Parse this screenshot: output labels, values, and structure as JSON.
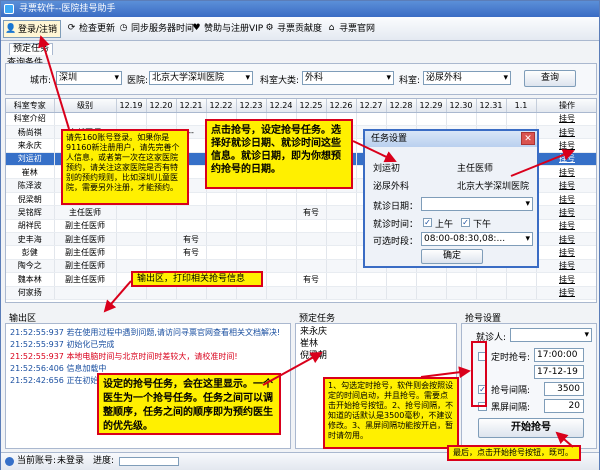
{
  "window": {
    "title": "寻票软件--医院挂号助手"
  },
  "toolbar": {
    "items": [
      {
        "label": "登录/注销",
        "icon": "user-icon"
      },
      {
        "label": "检查更新",
        "icon": "refresh-icon"
      },
      {
        "label": "同步服务器时间",
        "icon": "clock-icon"
      },
      {
        "label": "赞助与注册VIP",
        "icon": "heart-icon"
      },
      {
        "label": "寻票贡献度",
        "icon": "gear-icon"
      },
      {
        "label": "寻票官网",
        "icon": "home-icon"
      }
    ]
  },
  "tabs": {
    "appointment": "预定任务"
  },
  "query": {
    "section_label": "查询条件",
    "city_label": "城市:",
    "city_value": "深圳",
    "hospital_label": "医院:",
    "hospital_value": "北京大学深圳医院",
    "dept_type_label": "科室大类:",
    "dept_type_value": "外科",
    "dept_label": "科室:",
    "dept_value": "泌尿外科",
    "search_button": "查询"
  },
  "grid": {
    "headers": [
      "科室专家",
      "级别",
      "12.19",
      "12.20",
      "12.21",
      "12.22",
      "12.23",
      "12.24",
      "12.25",
      "12.26",
      "12.27",
      "12.28",
      "12.29",
      "12.30",
      "12.31",
      "1.1",
      "操作"
    ],
    "rows": [
      {
        "name": "科室介绍",
        "level": "",
        "cells": [
          "",
          "",
          "",
          "",
          "",
          "",
          "",
          "",
          "",
          "",
          "",
          "",
          "",
          ""
        ],
        "op": "挂号"
      },
      {
        "name": "杨尚祺",
        "level": "主任医师",
        "cells": [
          "--",
          "--",
          "--",
          "--",
          "--",
          "--",
          "--",
          "--",
          "--",
          "--",
          "--",
          "--",
          "--",
          "--"
        ],
        "op": "挂号"
      },
      {
        "name": "来永庆",
        "level": "",
        "cells": [
          "",
          "",
          "",
          "",
          "",
          "",
          "",
          "",
          "",
          "",
          "",
          "",
          "",
          ""
        ],
        "op": "挂号"
      },
      {
        "name": "刘运初",
        "level": "",
        "cells": [
          "",
          "",
          "",
          "",
          "",
          "",
          "",
          "",
          "",
          "",
          "",
          "",
          "",
          ""
        ],
        "op": "挂号"
      },
      {
        "name": "崔林",
        "level": "",
        "cells": [
          "",
          "",
          "",
          "",
          "",
          "",
          "",
          "",
          "",
          "",
          "",
          "",
          "",
          ""
        ],
        "op": "挂号"
      },
      {
        "name": "陈泽波",
        "level": "",
        "cells": [
          "",
          "",
          "",
          "",
          "",
          "",
          "",
          "",
          "",
          "",
          "",
          "",
          "",
          ""
        ],
        "op": "挂号"
      },
      {
        "name": "倪梁朝",
        "level": "",
        "cells": [
          "",
          "",
          "",
          "",
          "",
          "",
          "",
          "",
          "",
          "",
          "",
          "",
          "",
          ""
        ],
        "op": "挂号"
      },
      {
        "name": "吴铭辉",
        "level": "主任医师",
        "cells": [
          "",
          "",
          "",
          "",
          "",
          "",
          "有号",
          "",
          "",
          "",
          "",
          "",
          "",
          ""
        ],
        "op": "挂号"
      },
      {
        "name": "胡祥民",
        "level": "副主任医师",
        "cells": [
          "",
          "",
          "",
          "",
          "",
          "",
          "",
          "",
          "",
          "",
          "",
          "",
          "",
          ""
        ],
        "op": "挂号"
      },
      {
        "name": "史丰海",
        "level": "副主任医师",
        "cells": [
          "",
          "",
          "有号",
          "",
          "",
          "",
          "",
          "",
          "",
          "",
          "",
          "",
          "",
          ""
        ],
        "op": "挂号"
      },
      {
        "name": "彭健",
        "level": "副主任医师",
        "cells": [
          "",
          "",
          "有号",
          "",
          "",
          "",
          "",
          "",
          "",
          "",
          "",
          "",
          "",
          ""
        ],
        "op": "挂号"
      },
      {
        "name": "陶今之",
        "level": "副主任医师",
        "cells": [
          "",
          "",
          "",
          "",
          "",
          "",
          "",
          "",
          "",
          "",
          "",
          "",
          "",
          ""
        ],
        "op": "挂号"
      },
      {
        "name": "魏本林",
        "level": "副主任医师",
        "cells": [
          "",
          "",
          "有号",
          "",
          "",
          "",
          "有号",
          "",
          "",
          "",
          "",
          "",
          "",
          ""
        ],
        "op": "挂号"
      },
      {
        "name": "何家扬",
        "level": "",
        "cells": [
          "",
          "",
          "",
          "",
          "",
          "",
          "",
          "",
          "",
          "",
          "",
          "",
          "",
          ""
        ],
        "op": "挂号"
      }
    ]
  },
  "login_tip": "请先160账号登录。如果你是91160新注册用户，请先完善个人信息，或者第一次在这家医院预约，请关注这家医院是否有特别的预约规则，比如深圳儿童医院，需要另外注册，才能预约。",
  "dialog": {
    "title": "任务设置",
    "doctor": "刘运初",
    "level": "主任医师",
    "dept": "泌尿外科",
    "hospital": "北京大学深圳医院",
    "date_label": "就诊日期：",
    "date_value": "",
    "time_label": "就诊时间：",
    "am_label": "上午",
    "pm_label": "下午",
    "slot_label": "可选时段：",
    "slot_value": "08:00-08:30,08:...",
    "ok_button": "确定"
  },
  "tip_grab": "点击抢号，设定抢号任务。选择好就诊日期、就诊时间这些信息。就诊日期，即为你想预约抢号的日期。",
  "output": {
    "title": "输出区",
    "lines": [
      {
        "text": "21:52:55:937  若在使用过程中遇到问题,请访问寻票官网查看相关文档解决!",
        "color": "#1a4fa0"
      },
      {
        "text": "21:52:55:937  初始化已完成",
        "color": "#1a4fa0"
      },
      {
        "text": "21:52:55:937  本地电脑时间与北京时间时差较大，请校准时间!",
        "color": "#d9001b"
      },
      {
        "text": "21:52:56:406  信息加载中",
        "color": "#1a4fa0"
      },
      {
        "text": "21:52:42:656  正在初始化",
        "color": "#1a4fa0"
      }
    ]
  },
  "tip_output": "输出区，打印相关抢号信息",
  "task": {
    "title": "预定任务",
    "items": [
      "来永庆",
      "崔林",
      "倪梁朝"
    ]
  },
  "tip_task": "设定的抢号任务，会在这里显示。一个医生为一个抢号任务。任务之间可以调整顺序，任务之间的顺序即为预约医生的优先级。",
  "settings": {
    "title": "抢号设置",
    "patient_label": "就诊人:",
    "patient_value": "",
    "timed_label": "定时抢号:",
    "timed_time": "17:00:00",
    "timed_date": "17-12-19",
    "interval_label": "抢号间隔:",
    "interval_value": "3500",
    "black_label": "黑屏间隔:",
    "black_value": "20",
    "start_button": "开始抢号"
  },
  "tip_settings": "1、勾选定时抢号，软件则会按照设定的时间启动，并且抢号。需要点击开始抢号按钮。2、抢号间隔，不知道的话默认是3500毫秒，不建议修改。3、黑屏间隔功能按开启，暂时请勿用。",
  "tip_start": "最后，点击开始抢号按钮，既可。",
  "status": {
    "account_label": "当前账号:",
    "account_value": "未登录",
    "progress_label": "进度:"
  },
  "colors": {
    "accent": "#3670c8",
    "callout": "#fff000",
    "callout_border": "#d9001b"
  }
}
